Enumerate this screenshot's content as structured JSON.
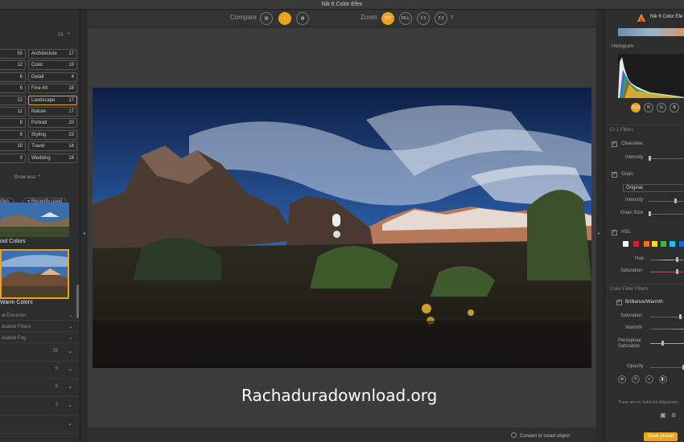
{
  "window": {
    "title": "Nik 6 Color Efex"
  },
  "left_panel": {
    "header_count": "55",
    "categories": [
      [
        {
          "label": "",
          "count": "55"
        },
        {
          "label": "Architecture",
          "count": "17"
        }
      ],
      [
        {
          "label": "",
          "count": "12"
        },
        {
          "label": "Color",
          "count": "19"
        }
      ],
      [
        {
          "label": "",
          "count": "6"
        },
        {
          "label": "Detail",
          "count": "4"
        }
      ],
      [
        {
          "label": "",
          "count": "6"
        },
        {
          "label": "Fine Art",
          "count": "18"
        }
      ],
      [
        {
          "label": "",
          "count": "12"
        },
        {
          "label": "Landscape",
          "count": "17",
          "selected": true
        }
      ],
      [
        {
          "label": "",
          "count": "11"
        },
        {
          "label": "Nature",
          "count": "17"
        }
      ],
      [
        {
          "label": "",
          "count": "8"
        },
        {
          "label": "Portrait",
          "count": "20"
        }
      ],
      [
        {
          "label": "",
          "count": "8"
        },
        {
          "label": "Styling",
          "count": "23"
        }
      ],
      [
        {
          "label": "",
          "count": "19"
        },
        {
          "label": "Travel",
          "count": "14"
        }
      ],
      [
        {
          "label": "",
          "count": "9"
        },
        {
          "label": "Wedding",
          "count": "18"
        }
      ]
    ],
    "show_less": "Show less",
    "favorites_pill": "rites",
    "recent_pill": "Recently used",
    "presets": [
      {
        "label": "ool Colors"
      },
      {
        "label": "Warm Colors"
      }
    ],
    "sections": [
      {
        "label": "al Extractor"
      },
      {
        "label": "duated Filters"
      },
      {
        "label": "duated Fog"
      }
    ],
    "rows": [
      {
        "num": "39"
      },
      {
        "num": "6"
      },
      {
        "num": "6"
      },
      {
        "num": "3"
      },
      {
        "num": ""
      }
    ]
  },
  "toolbar": {
    "compare_label": "Compare",
    "zoom_label": "Zoom",
    "zoom_buttons": [
      "FIT",
      "FILL",
      "1:1",
      "2:1"
    ]
  },
  "watermark": "Rachaduradownload.org",
  "bottom": {
    "smart_object": "Convert to smart object"
  },
  "right_panel": {
    "title": "Nik 6 Color Efe",
    "histogram_label": "Histogram",
    "channels": [
      "RGB",
      "R",
      "G",
      "B"
    ],
    "group1": "Cr 1 Filters",
    "clearview": "Clearview",
    "intensity": "Intensity",
    "grain": "Grain",
    "grain_type": "Original",
    "grain_intensity": "Intensity",
    "grain_size": "Grain Size",
    "hsl": "HSL",
    "hue": "Hue",
    "saturation": "Saturation",
    "group2": "Color Filter Filters",
    "brilliance": "Brilliance/Warmth",
    "b_saturation": "Saturation",
    "b_warmth": "Warmth",
    "b_perceptual": "Perceptual Saturation",
    "opacity": "Opacity",
    "note": "There are no Selective Adjustmen",
    "save": "Save preset",
    "colors": {
      "accent": "#e9a321",
      "swatches": [
        "#ffffff",
        "#e02020",
        "#f07020",
        "#f0e020",
        "#30c030",
        "#20c0e0",
        "#2060e0"
      ]
    }
  }
}
